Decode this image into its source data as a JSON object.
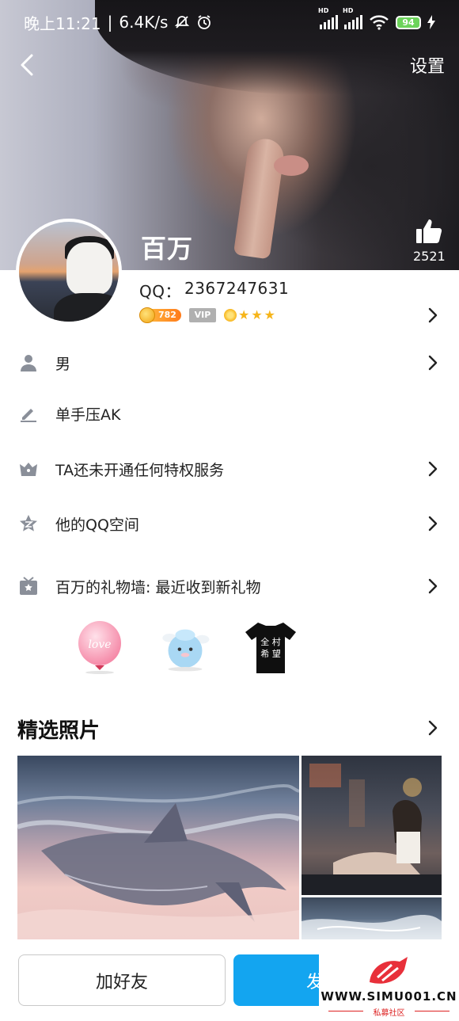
{
  "status_bar": {
    "time": "晚上11:21",
    "speed": "6.4K/s",
    "battery": "94",
    "hd": "HD"
  },
  "header": {
    "back_icon": "chevron-left-icon",
    "settings_label": "设置",
    "likes_count": "2521"
  },
  "profile": {
    "nickname": "百万",
    "qq_label": "QQ：",
    "qq_number": "2367247631",
    "coin_level": "782",
    "vip_label": "VIP",
    "level_icons": [
      "sun-icon",
      "star-icon",
      "star-icon",
      "star-icon"
    ]
  },
  "info_rows": [
    {
      "icon": "person-icon",
      "label": "男"
    },
    {
      "icon": "pen-icon",
      "label": "单手压AK"
    },
    {
      "icon": "crown-icon",
      "label": "TA还未开通任何特权服务"
    },
    {
      "icon": "qzone-star-icon",
      "label": "他的QQ空间"
    },
    {
      "icon": "gift-box-icon",
      "label": "百万的礼物墙: 最近收到新礼物"
    }
  ],
  "gifts": [
    {
      "name": "love-balloon",
      "text": "love"
    },
    {
      "name": "blue-alpaca-plush",
      "text": ""
    },
    {
      "name": "black-tshirt",
      "text": "全 村 的 希 望"
    }
  ],
  "photos_section": {
    "title": "精选照片"
  },
  "actions": {
    "add_friend": "加好友",
    "send_message_partial": "发"
  },
  "watermark": {
    "url": "WWW.SIMU001.CN",
    "sub": "私募社区"
  },
  "colors": {
    "primary_blue": "#13a5f0",
    "icon_gray": "#8a8f99",
    "coin_orange": "#ff8a1e",
    "battery_green": "#6cd35b"
  }
}
